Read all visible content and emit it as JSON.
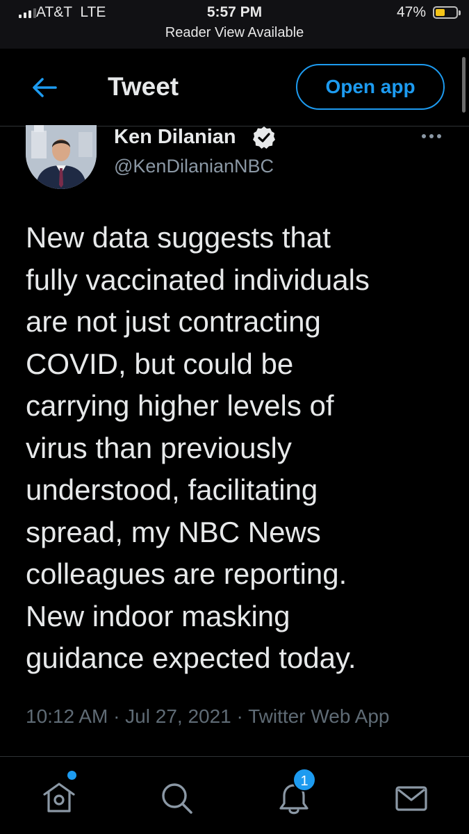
{
  "status_bar": {
    "carrier": "AT&T  LTE",
    "time": "5:57 PM",
    "reader_view": "Reader View Available",
    "battery_percent": "47%",
    "battery_level": 0.47
  },
  "header": {
    "title": "Tweet",
    "open_app_label": "Open app",
    "back_icon": "arrow-left-icon"
  },
  "tweet": {
    "author_name": "Ken Dilanian",
    "handle": "@KenDilanianNBC",
    "verified_icon": "verified-badge-icon",
    "text": "New data suggests that\nfully vaccinated individuals\nare not just contracting\nCOVID, but could be\ncarrying higher levels of\nvirus than previously\nunderstood, facilitating\nspread, my NBC News\ncolleagues are reporting.\nNew indoor masking\nguidance expected today.",
    "meta": "10:12 AM · Jul 27, 2021 · Twitter Web App"
  },
  "bottom_nav": {
    "items": [
      {
        "icon": "home-icon",
        "has_dot": true
      },
      {
        "icon": "search-icon"
      },
      {
        "icon": "notifications-bell-icon",
        "badge": "1"
      },
      {
        "icon": "messages-envelope-icon"
      }
    ]
  },
  "colors": {
    "accent": "#1d9bf0",
    "background": "#000000",
    "text_primary": "#e7e9ea",
    "text_secondary": "#8b98a5"
  }
}
